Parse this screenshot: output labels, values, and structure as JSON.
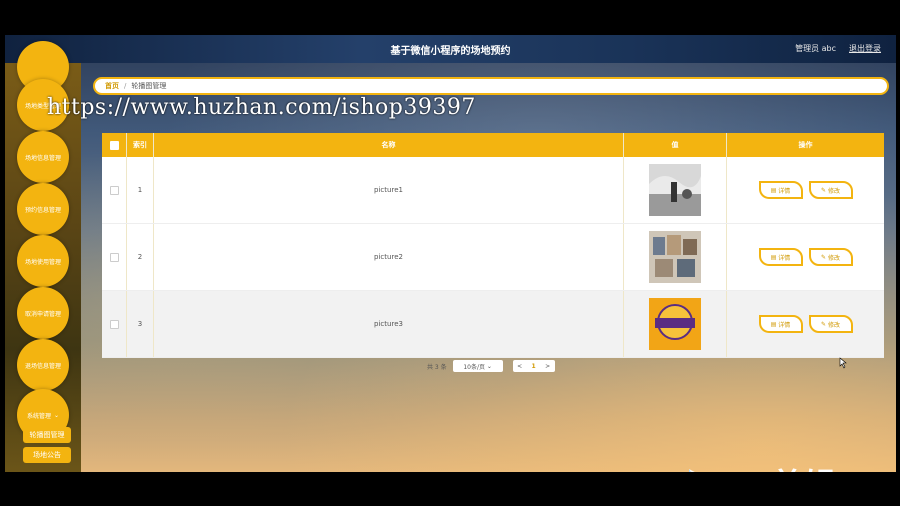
{
  "header": {
    "title": "基于微信小程序的场地预约",
    "admin": "管理员 abc",
    "logout": "退出登录"
  },
  "sidebar": {
    "items": [
      {
        "label": "场地类型管理"
      },
      {
        "label": "场地信息管理"
      },
      {
        "label": "预约信息管理"
      },
      {
        "label": "场地使用管理"
      },
      {
        "label": "取消申请管理"
      },
      {
        "label": "退场信息管理"
      },
      {
        "label": "系统管理"
      }
    ],
    "submenu": [
      {
        "label": "轮播图管理"
      },
      {
        "label": "场地公告"
      }
    ]
  },
  "breadcrumb": {
    "home": "首页",
    "sep": "/",
    "current": "轮播图管理"
  },
  "overlay_url": "https://www.huzhan.com/ishop39397",
  "table": {
    "headers": {
      "index": "索引",
      "name": "名称",
      "value": "值",
      "actions": "操作"
    },
    "rows": [
      {
        "index": "1",
        "name": "picture1",
        "thumb": "photo-gray"
      },
      {
        "index": "2",
        "name": "picture2",
        "thumb": "photo-collage"
      },
      {
        "index": "3",
        "name": "picture3",
        "thumb": "lakers-logo"
      }
    ],
    "detail_label": "详情",
    "edit_label": "修改"
  },
  "pagination": {
    "total": "共 3 条",
    "page_size": "10条/页",
    "prev": "<",
    "current": "1",
    "next": ">"
  },
  "colors": {
    "accent": "#f3b410",
    "sidebar": "#5a4515"
  },
  "watermark": {
    "text": "eV剪辑"
  }
}
